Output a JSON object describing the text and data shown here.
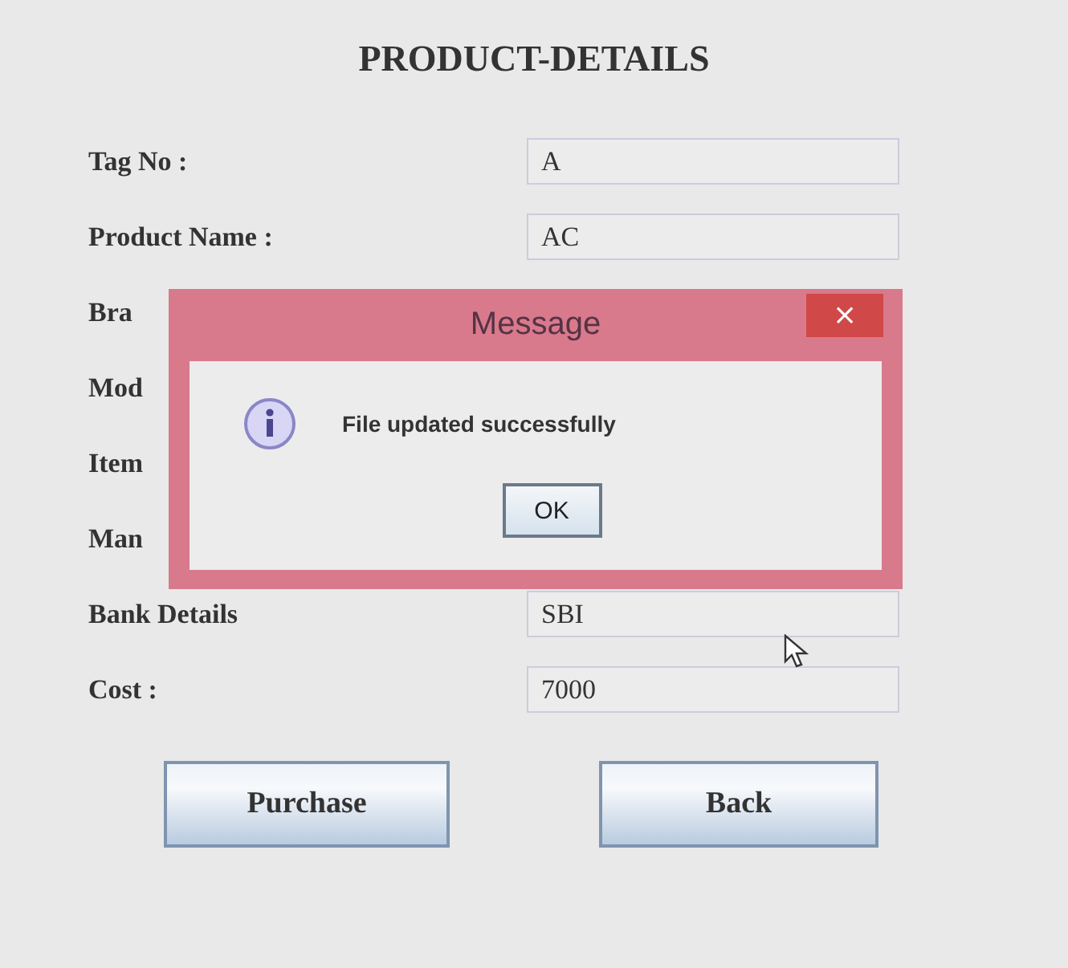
{
  "title": "PRODUCT-DETAILS",
  "rows": [
    {
      "label": "Tag No :",
      "value": "A"
    },
    {
      "label": "Product Name :",
      "value": "AC"
    },
    {
      "label": "Bra"
    },
    {
      "label": "Mod"
    },
    {
      "label": "Item"
    },
    {
      "label": "Man"
    },
    {
      "label": "Bank Details",
      "value": "SBI"
    },
    {
      "label": "Cost :",
      "value": "7000"
    }
  ],
  "buttons": [
    "Purchase",
    "Back"
  ],
  "dialog": {
    "title": "Message",
    "close": "×",
    "message": "File updated successfully",
    "button": "OK"
  }
}
